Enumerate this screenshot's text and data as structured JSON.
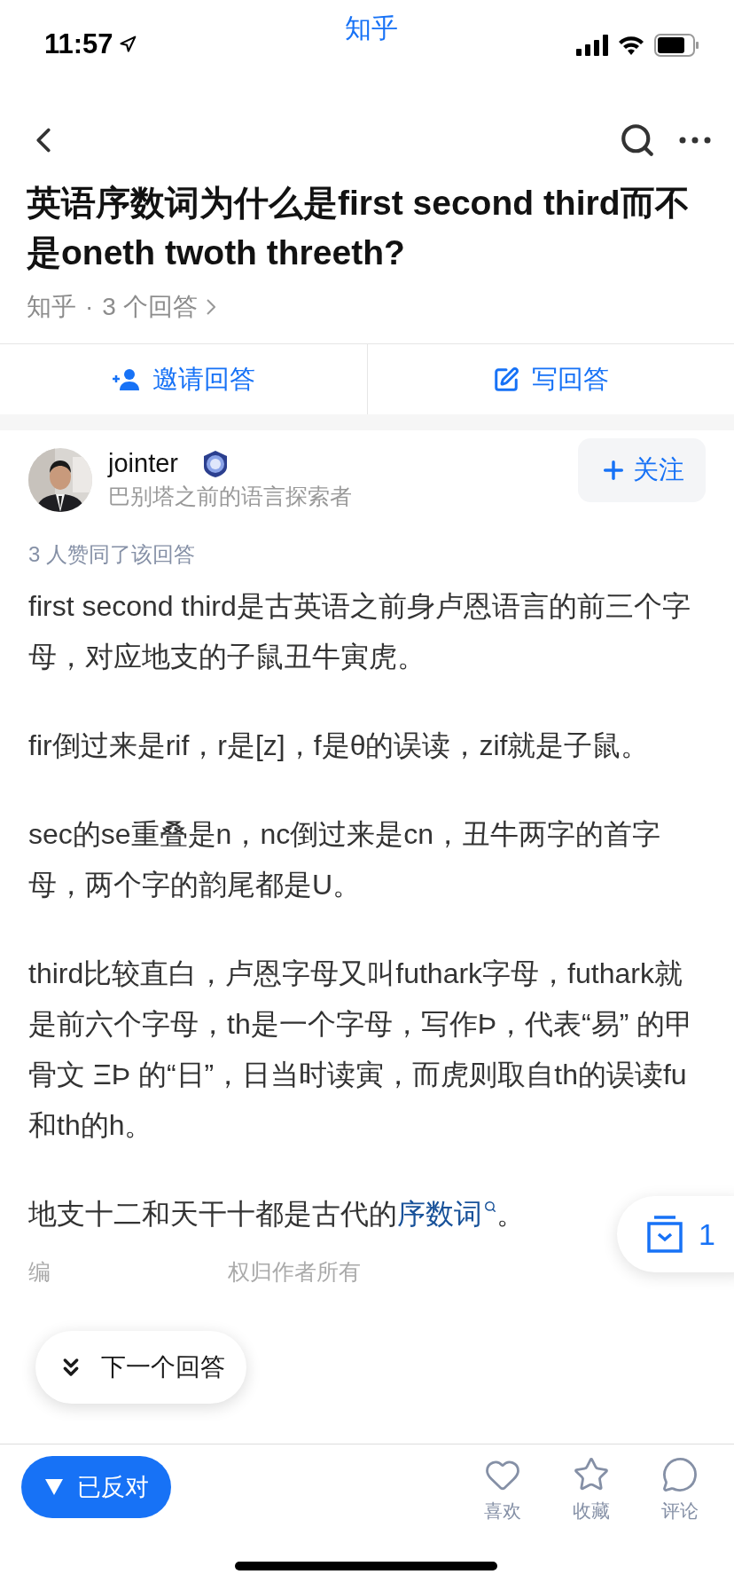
{
  "status_bar": {
    "time": "11:57",
    "app": "知乎"
  },
  "question": {
    "title": "英语序数词为什么是first second third而不是oneth twoth threeth?",
    "source": "知乎",
    "separator": "·",
    "answer_count": "3 个回答"
  },
  "actions": [
    {
      "label": "邀请回答",
      "kind": "invite"
    },
    {
      "label": "写回答",
      "kind": "write"
    }
  ],
  "answer": {
    "author": {
      "name": "jointer",
      "bio": "巴别塔之前的语言探索者",
      "follow_label": "关注"
    },
    "votes": "3 人赞同了该回答",
    "paragraphs": [
      [
        {
          "kind": "text",
          "text": "first second third是古英语之前身卢恩语言的前三个字母，对应地支的子鼠丑牛寅虎。"
        }
      ],
      [
        {
          "kind": "text",
          "text": "fir倒过来是rif，r是[z]，f是θ的误读，zif就是子鼠。"
        }
      ],
      [
        {
          "kind": "text",
          "text": "sec的se重叠是n，nc倒过来是cn，丑牛两字的首字母，两个字的韵尾都是U。"
        }
      ],
      [
        {
          "kind": "text",
          "text": "third比较直白，卢恩字母又叫futhark字母，futhark就是前六个字母，th是一个字母，写作Þ，代表“易” 的甲骨文 ΞÞ 的“日”，日当时读寅，而虎则取自th的误读fu和th的h。"
        }
      ],
      [
        {
          "kind": "text",
          "text": "地支十二和天干十都是古代的"
        },
        {
          "kind": "link",
          "text": "序数词"
        },
        {
          "kind": "text",
          "text": "。"
        }
      ]
    ],
    "footer_parts": [
      "编",
      "权归作者所有"
    ]
  },
  "next_answer": {
    "label": "下一个回答"
  },
  "collect_float": {
    "count": "1"
  },
  "bottom_bar": {
    "vote": {
      "label": "已反对",
      "selected": true
    },
    "items": [
      {
        "kind": "like",
        "label": "喜欢"
      },
      {
        "kind": "collect",
        "label": "收藏"
      },
      {
        "kind": "comment",
        "label": "评论"
      }
    ]
  }
}
